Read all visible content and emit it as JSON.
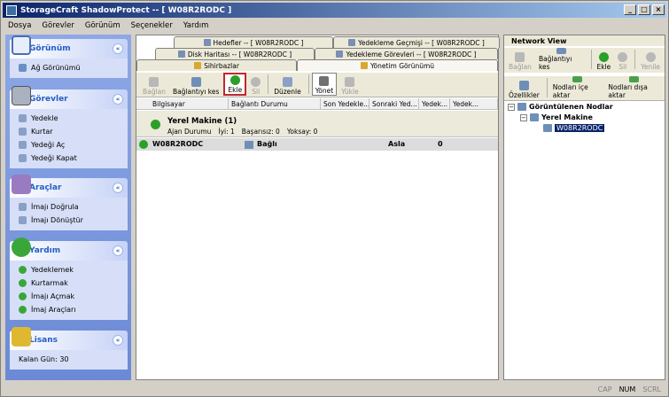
{
  "window": {
    "title": "StorageCraft ShadowProtect -- [ W08R2RODC ]"
  },
  "menu": [
    "Dosya",
    "Görevler",
    "Görünüm",
    "Seçenekler",
    "Yardım"
  ],
  "sidebar": {
    "gorunum": {
      "title": "Görünüm",
      "items": [
        "Ağ Görünümü"
      ]
    },
    "gorevler": {
      "title": "Görevler",
      "items": [
        "Yedekle",
        "Kurtar",
        "Yedeği Aç",
        "Yedeği Kapat"
      ]
    },
    "araclar": {
      "title": "Araçlar",
      "items": [
        "İmajı Doğrula",
        "İmajı Dönüştür"
      ]
    },
    "yardim": {
      "title": "Yardım",
      "items": [
        "Yedeklemek",
        "Kurtarmak",
        "İmajı Açmak",
        "İmaj Araçları"
      ]
    },
    "lisans": {
      "title": "Lisans",
      "items": [
        "Kalan Gün: 30"
      ]
    }
  },
  "tabs": {
    "row1": [
      "Hedefler -- [ W08R2RODC ]",
      "Yedekleme Geçmişi -- [ W08R2RODC ]"
    ],
    "row2": [
      "Disk Haritası -- [ W08R2RODC ]",
      "Yedekleme Görevleri -- [ W08R2RODC ]"
    ],
    "row3": [
      "Sihirbazlar",
      "Yönetim Görünümü"
    ]
  },
  "toolbar": {
    "baglan": "Bağlan",
    "baglantiyi_kes": "Bağlantıyı kes",
    "ekle": "Ekle",
    "sil": "Sil",
    "duzenle": "Düzenle",
    "yonet": "Yönet",
    "yukle": "Yükle"
  },
  "columns": [
    "Bilgisayar",
    "Bağlantı Durumu",
    "Son Yedekle...",
    "Sonraki Yed...",
    "Yedek...",
    "Yedek..."
  ],
  "group": {
    "title": "Yerel Makine (1)",
    "agent": "Ajan Durumu",
    "iyi": "İyi: 1",
    "basarisiz": "Başarısız: 0",
    "yoksay": "Yoksay: 0"
  },
  "row": {
    "computer": "W08R2RODC",
    "status": "Bağlı",
    "next": "Asla",
    "count": "0"
  },
  "network": {
    "title": "Network View",
    "tb1": {
      "baglan": "Bağlan",
      "baglantiyi_kes": "Bağlantıyı kes",
      "ekle": "Ekle",
      "sil": "Sil",
      "yenile": "Yenile"
    },
    "tb2": {
      "ozellikler": "Özellikler",
      "ice_aktar": "Nodları içe aktar",
      "disa_aktar": "Nodları dışa aktar"
    },
    "tree": {
      "root": "Görüntülenen Nodlar",
      "group": "Yerel Makine",
      "node": "W08R2RODC"
    }
  },
  "status": {
    "cap": "CAP",
    "num": "NUM",
    "scrl": "SCRL"
  },
  "colors": {
    "sidebar": "#7a96df",
    "highlight": "#c0282d",
    "selection": "#0a246a"
  }
}
